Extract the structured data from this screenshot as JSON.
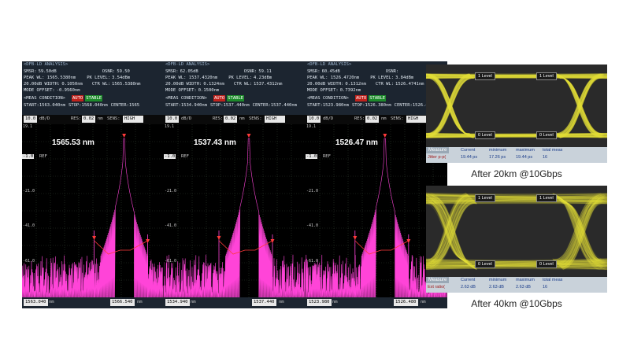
{
  "spectra": [
    {
      "header": {
        "title": "<DFB-LD ANALYSIS>",
        "smsr": "SMSR:",
        "smsr_val": "59.50dB",
        "osnr": "OSNR:",
        "osnr_val": "59.50",
        "peak_wl": "PEAK WL: 1565.5380nm",
        "pk_level": "PK LEVEL:",
        "pk_level_val": "3.54dBm",
        "width": "20.00dB WIDTH:",
        "width_val": "0.1050nm",
        "ctr_wl": "CTR WL:",
        "ctr_wl_val": "1565.5380nm",
        "mode_offset": "MODE OFFSET:",
        "mode_offset_val": "-0.9560nm",
        "meas": "<MEAS CONDITION>",
        "tag_red": "AUTO",
        "tag_grn": "STABLE",
        "start": "START:1563.040nm",
        "stop": "STOP:1568.040nm",
        "center": "CENTER:1565"
      },
      "sub": {
        "scale": "10.0",
        "unit": "dB/D",
        "res_lbl": "RES:",
        "res": "0.02",
        "res_unit": "nm",
        "sens_lbl": "SENS:",
        "sens": "HIGH"
      },
      "ytop": "19.1",
      "ref_chip": "-1.0",
      "ref_lbl": "REF",
      "yticks": [
        "-21.0",
        "-41.0",
        "-61.0"
      ],
      "wavelength_label": "1565.53 nm",
      "peak_x": 0.72,
      "footer": {
        "start": "1563.040",
        "stop": "1566.540",
        "unit": "nm"
      }
    },
    {
      "header": {
        "title": "<DFB-LD ANALYSIS>",
        "smsr": "SMSR:",
        "smsr_val": "62.05dB",
        "osnr": "OSNR:",
        "osnr_val": "59.11",
        "peak_wl": "PEAK WL: 1537.4320nm",
        "pk_level": "PK LEVEL:",
        "pk_level_val": "4.23dBm",
        "width": "20.00dB WIDTH:",
        "width_val": "0.1324nm",
        "ctr_wl": "CTR WL:",
        "ctr_wl_val": "1537.4312nm",
        "mode_offset": "MODE OFFSET:",
        "mode_offset_val": "0.1500nm",
        "meas": "<MEAS CONDITION>",
        "tag_red": "AUTO",
        "tag_grn": "STABLE",
        "start": "START:1534.940nm",
        "stop": "STOP:1537.440nm",
        "center": "CENTER:1537.440nm"
      },
      "sub": {
        "scale": "10.0",
        "unit": "dB/D",
        "res_lbl": "RES:",
        "res": "0.02",
        "res_unit": "nm",
        "sens_lbl": "SENS:",
        "sens": "HIGH"
      },
      "ytop": "19.1",
      "ref_chip": "-1.0",
      "ref_lbl": "REF",
      "yticks": [
        "-21.0",
        "-41.0",
        "-61.0"
      ],
      "wavelength_label": "1537.43 nm",
      "peak_x": 0.6,
      "footer": {
        "start": "1534.940",
        "stop": "1537.440",
        "unit": "nm"
      }
    },
    {
      "header": {
        "title": "<DFB-LD ANALYSIS>",
        "smsr": "SMSR:",
        "smsr_val": "60.45dB",
        "osnr": "OSNR:",
        "osnr_val": "",
        "peak_wl": "PEAK WL: 1526.4720nm",
        "pk_level": "PK LEVEL:",
        "pk_level_val": "3.84dBm",
        "width": "20.00dB WIDTH:",
        "width_val": "0.1312nm",
        "ctr_wl": "CTR WL:",
        "ctr_wl_val": "1526.4741nm",
        "mode_offset": "MODE OFFSET:",
        "mode_offset_val": "0.7392nm",
        "meas": "<MEAS CONDITION>",
        "tag_red": "AUTO",
        "tag_grn": "STABLE",
        "start": "START:1523.980nm",
        "stop": "STOP:1526.380nm",
        "center": "CENTER:1526.4"
      },
      "sub": {
        "scale": "10.0",
        "unit": "dB/D",
        "res_lbl": "RES:",
        "res": "0.02",
        "res_unit": "nm",
        "sens_lbl": "SENS:",
        "sens": "HIGH"
      },
      "ytop": "19.1",
      "ref_chip": "-1.0",
      "ref_lbl": "REF",
      "yticks": [
        "-21.0",
        "-41.0",
        "-61.0"
      ],
      "wavelength_label": "1526.47 nm",
      "peak_x": 0.56,
      "footer": {
        "start": "1523.980",
        "stop": "1526.480",
        "unit": "nm"
      }
    }
  ],
  "eyes": [
    {
      "caption": "After 20km @10Gbps",
      "top_left": "1 Level",
      "top_right": "1 Level",
      "bot_left": "0 Level",
      "bot_right": "0 Level",
      "measure": {
        "tab": "Measure",
        "name": "Jitter p-p(",
        "cols": [
          "Current",
          "minimum",
          "maximum",
          "total meas"
        ],
        "vals": [
          "19.44 ps",
          "17.26 ps",
          "19.44 ps",
          "16"
        ]
      }
    },
    {
      "caption": "After 40km @10Gbps",
      "top_left": "1 Level",
      "top_right": "1 Level",
      "bot_left": "0 Level",
      "bot_right": "0 Level",
      "measure": {
        "tab": "Measure",
        "name": "Ext ratio(",
        "cols": [
          "Current",
          "minimum",
          "maximum",
          "total meas"
        ],
        "vals": [
          "2.63 dB",
          "2.63 dB",
          "2.63 dB",
          "16"
        ]
      }
    }
  ],
  "colors": {
    "trace": "#ff44d8",
    "marker": "#ff3a3a",
    "eye": "#e6e23c"
  }
}
